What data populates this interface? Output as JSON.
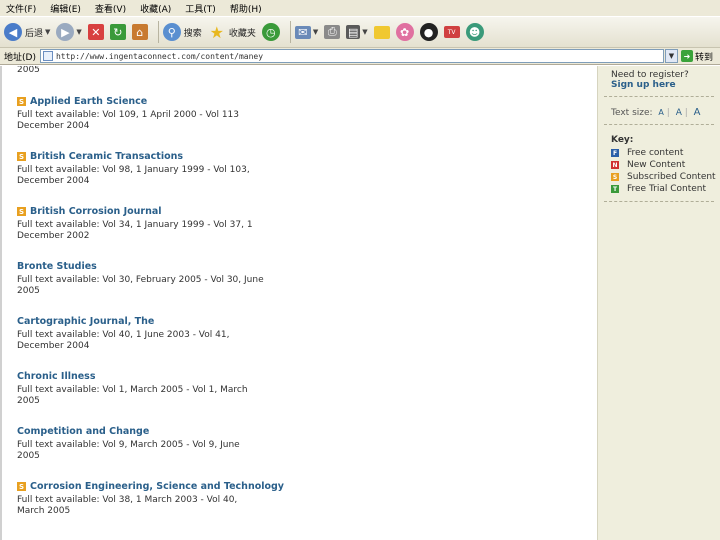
{
  "menu": [
    "文件(F)",
    "编辑(E)",
    "查看(V)",
    "收藏(A)",
    "工具(T)",
    "帮助(H)"
  ],
  "toolbar": {
    "back_label": "后退",
    "search_label": "搜索",
    "favorites_label": "收藏夹"
  },
  "address": {
    "label": "地址(D)",
    "url": "http://www.ingentaconnect.com/content/maney",
    "go_label": "转到"
  },
  "journals": [
    {
      "title": "",
      "badge": "",
      "availability": "",
      "tail": "2005"
    },
    {
      "title": "Applied Earth Science",
      "badge": "S",
      "availability": "Full text available: Vol 109, 1 April 2000 - Vol 113",
      "tail": "December 2004"
    },
    {
      "title": "British Ceramic Transactions",
      "badge": "S",
      "availability": "Full text available: Vol 98, 1 January 1999 - Vol 103,",
      "tail": "December 2004"
    },
    {
      "title": "British Corrosion Journal",
      "badge": "S",
      "availability": "Full text available: Vol 34, 1 January 1999 - Vol 37, 1",
      "tail": "December 2002"
    },
    {
      "title": "Bronte Studies",
      "badge": "",
      "availability": "Full text available: Vol 30, February 2005 - Vol 30, June",
      "tail": "2005"
    },
    {
      "title": "Cartographic Journal, The",
      "badge": "",
      "availability": "Full text available: Vol 40, 1 June 2003 - Vol 41,",
      "tail": "December 2004"
    },
    {
      "title": "Chronic Illness",
      "badge": "",
      "availability": "Full text available: Vol 1, March 2005 - Vol 1, March",
      "tail": "2005"
    },
    {
      "title": "Competition and Change",
      "badge": "",
      "availability": "Full text available: Vol 9, March 2005 - Vol 9, June",
      "tail": "2005"
    },
    {
      "title": "Corrosion Engineering, Science and Technology",
      "badge": "S",
      "availability": "Full text available: Vol 38, 1 March 2003 - Vol 40,",
      "tail": "March 2005"
    }
  ],
  "sidebar": {
    "register_q": "Need to register?",
    "register_link": "Sign up here",
    "text_size_label": "Text size:",
    "text_sizes": [
      "A",
      "A",
      "A"
    ],
    "key_heading": "Key:",
    "key_items": [
      {
        "code": "F",
        "label": "Free content",
        "color": "#2b5fa8"
      },
      {
        "code": "N",
        "label": "New Content",
        "color": "#d03030"
      },
      {
        "code": "S",
        "label": "Subscribed Content",
        "color": "#e8a020"
      },
      {
        "code": "T",
        "label": "Free Trial Content",
        "color": "#3a9a3a"
      }
    ]
  }
}
